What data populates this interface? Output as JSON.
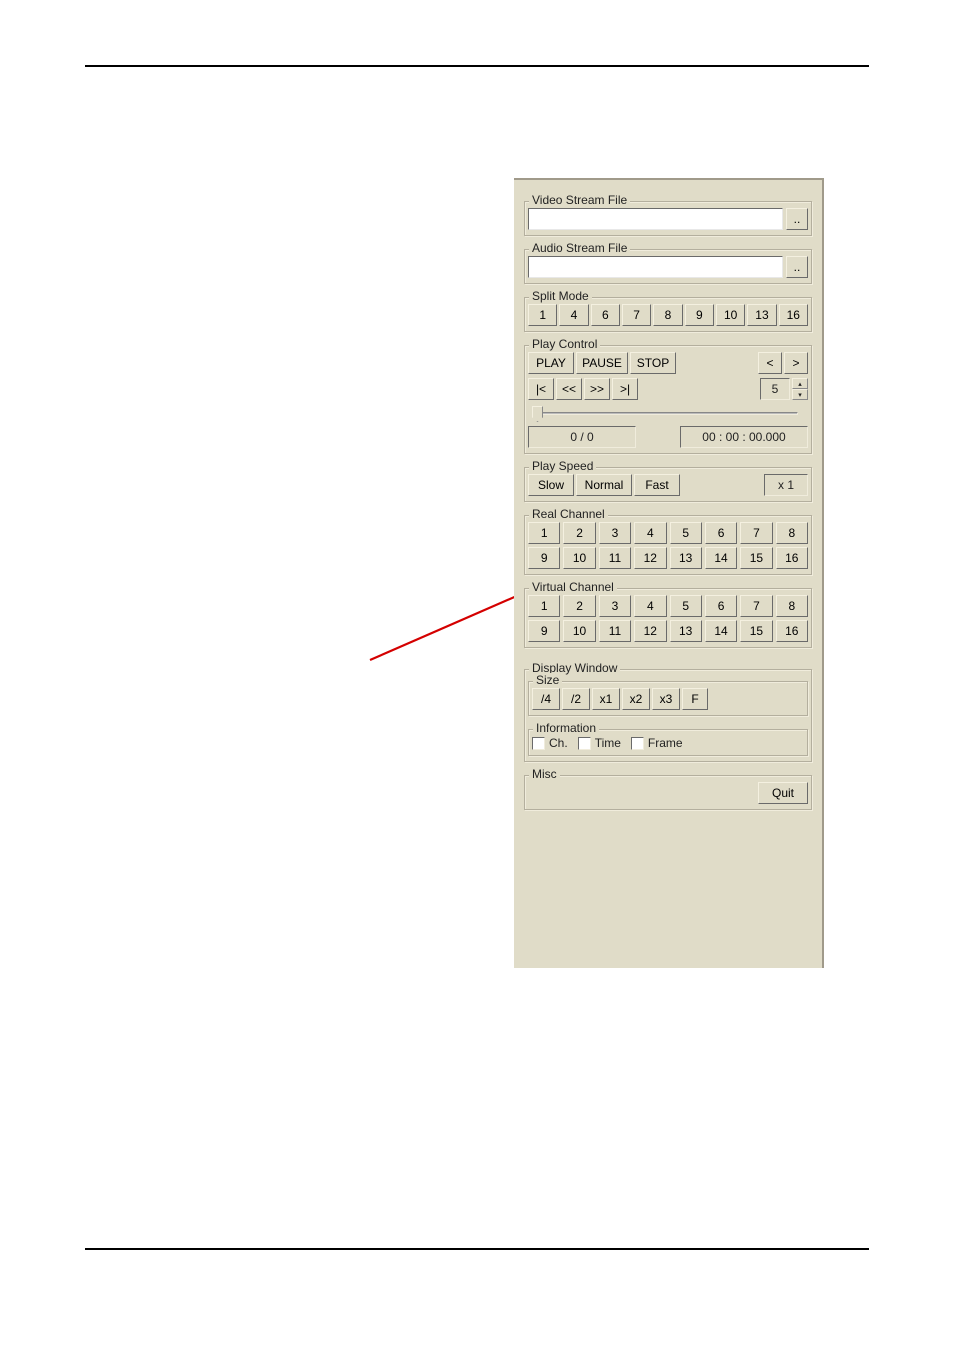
{
  "video_stream_file": {
    "legend": "Video Stream File",
    "value": "",
    "browse": ".."
  },
  "audio_stream_file": {
    "legend": "Audio Stream File",
    "value": "",
    "browse": ".."
  },
  "split_mode": {
    "legend": "Split Mode",
    "buttons": [
      "1",
      "4",
      "6",
      "7",
      "8",
      "9",
      "10",
      "13",
      "16"
    ]
  },
  "play_control": {
    "legend": "Play Control",
    "play": "PLAY",
    "pause": "PAUSE",
    "stop": "STOP",
    "prev": "<",
    "next": ">",
    "first": "|<",
    "rev": "<<",
    "fwd": ">>",
    "last": ">|",
    "step_value": "5",
    "frame_counter": "0 / 0",
    "timecode": "00 : 00 : 00.000"
  },
  "play_speed": {
    "legend": "Play Speed",
    "slow": "Slow",
    "normal": "Normal",
    "fast": "Fast",
    "speed": "x 1"
  },
  "real_channel": {
    "legend": "Real Channel",
    "row1": [
      "1",
      "2",
      "3",
      "4",
      "5",
      "6",
      "7",
      "8"
    ],
    "row2": [
      "9",
      "10",
      "11",
      "12",
      "13",
      "14",
      "15",
      "16"
    ]
  },
  "virtual_channel": {
    "legend": "Virtual Channel",
    "row1": [
      "1",
      "2",
      "3",
      "4",
      "5",
      "6",
      "7",
      "8"
    ],
    "row2": [
      "9",
      "10",
      "11",
      "12",
      "13",
      "14",
      "15",
      "16"
    ]
  },
  "display_window": {
    "legend": "Display Window",
    "size_legend": "Size",
    "sizes": [
      "/4",
      "/2",
      "x1",
      "x2",
      "x3",
      "F"
    ],
    "info_legend": "Information",
    "ch_label": "Ch.",
    "time_label": "Time",
    "frame_label": "Frame"
  },
  "misc": {
    "legend": "Misc",
    "quit": "Quit"
  }
}
